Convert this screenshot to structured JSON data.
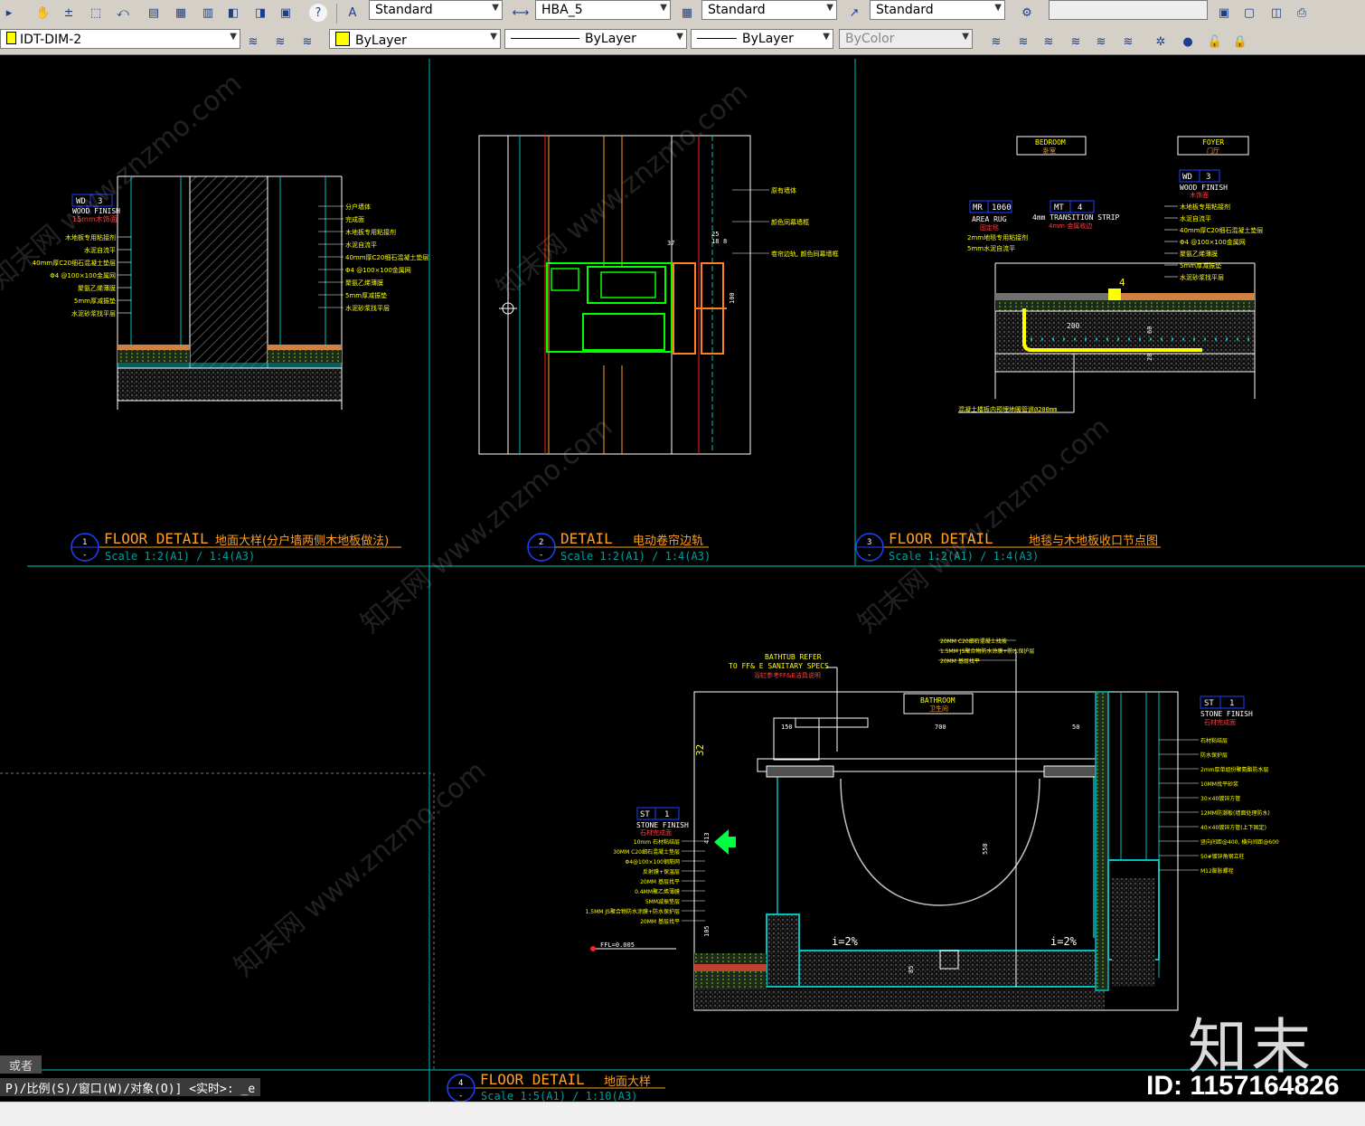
{
  "toolbar_top": {
    "text_style": "Standard",
    "dim_style": "HBA_5",
    "table_style": "Standard",
    "mleader_style": "Standard",
    "search_value": ""
  },
  "toolbar_props": {
    "layer": "IDT-DIM-2",
    "color": "ByLayer",
    "linetype": "ByLayer",
    "lineweight": "ByLayer",
    "plotstyle": "ByColor"
  },
  "colors": {
    "viewport_border": "#00a0a0",
    "title_text": "#ffa020",
    "annotation": "#ffff00",
    "background": "#000000"
  },
  "details": [
    {
      "num": "1",
      "sub": "-",
      "title_en": "FLOOR DETAIL",
      "title_cn": "地面大样(分户墙两侧木地板做法)",
      "scale": "Scale 1:2(A1) / 1:4(A3)"
    },
    {
      "num": "2",
      "sub": "-",
      "title_en": "DETAIL",
      "title_cn": "电动卷帘边轨",
      "scale": "Scale 1:2(A1) / 1:4(A3)"
    },
    {
      "num": "3",
      "sub": "-",
      "title_en": "FLOOR DETAIL",
      "title_cn": "地毯与木地板收口节点图",
      "scale": "Scale 1:2(A1) / 1:4(A3)"
    },
    {
      "num": "4",
      "sub": "-",
      "title_en": "FLOOR DETAIL",
      "title_cn": "地面大样",
      "scale": "Scale 1:5(A1) / 1:10(A3)"
    }
  ],
  "d1": {
    "tag_code": "WD",
    "tag_num": "3",
    "tag_en": "WOOD FINISH",
    "tag_cn": "15mm木饰面",
    "left_notes": [
      "木地板专用粘接剂",
      "水泥自流平",
      "40mm厚C20细石混凝土垫层",
      "Φ4 @100×100金属网",
      "聚氨乙烯薄膜",
      "5mm厚减振垫",
      "水泥砂浆找平层"
    ],
    "right_notes": [
      "分户墙体",
      "完成面",
      "木地板专用粘接剂",
      "水泥自流平",
      "40mm厚C20细石混凝土垫层",
      "Φ4 @100×100金属网",
      "聚氨乙烯薄膜",
      "5mm厚减振垫",
      "水泥砂浆找平层"
    ]
  },
  "d2": {
    "notes": [
      "原有墙体",
      "颜色同幕墙框",
      "卷帘边轨, 颜色同幕墙框"
    ],
    "dims": [
      "37",
      "25",
      "18",
      "8",
      "100"
    ]
  },
  "d3": {
    "bedroom": "BEDROOM",
    "bedroom_cn": "卧室",
    "foyer": "FOYER",
    "foyer_cn": "门厅",
    "mr_code": "MR",
    "mr_num": "1060",
    "mr_en": "AREA RUG",
    "mr_cn": "固定毯",
    "mt_code": "MT",
    "mt_num": "4",
    "mt_en": "4mm TRANSITION STRIP",
    "mt_cn": "4mm 金属收边",
    "wd_code": "WD",
    "wd_num": "3",
    "wd_en": "WOOD FINISH",
    "wd_cn": "木饰面",
    "left_notes": [
      "2mm地毯专用粘接剂",
      "5mm水泥自流平"
    ],
    "right_notes": [
      "木地板专用粘接剂",
      "水泥自流平",
      "40mm厚C20细石混凝土垫层",
      "Φ4 @100×100金属网",
      "聚氨乙烯薄膜",
      "5mm厚减振垫",
      "水泥砂浆找平层"
    ],
    "bottom_note": "混凝土楼板内预埋地暖管道@200mm",
    "dims": [
      "4",
      "200",
      "60",
      "20"
    ]
  },
  "d4": {
    "bath_ref1": "BATHTUB REFER",
    "bath_ref2": "TO FF& E SANITARY SPECS",
    "bath_ref3": "浴缸参考FF&E洁具说明",
    "bathroom": "BATHROOM",
    "bathroom_cn": "卫生间",
    "top_notes": [
      "20MM C20细石混凝土找坡",
      "1.5MM JS聚合物防水涂膜+防水保护层",
      "20MM 基层找平"
    ],
    "st1_code": "ST",
    "st1_num": "1",
    "st1_en": "STONE FINISH",
    "st1_cn": "石材完成面",
    "st2_code": "ST",
    "st2_num": "1",
    "st2_en": "STONE FINISH",
    "st2_cn": "石材完成面",
    "left_notes": [
      "10mm 石材粘结层",
      "30MM C20细石混凝土垫层",
      "Φ4@100×100钢筋网",
      "反射膜+保温层",
      "20MM 基层找平",
      "0.4MM聚乙烯薄膜",
      "5MM减振垫层",
      "1.5MM JS聚合物防水涂膜+防水保护层",
      "20MM 基层找平"
    ],
    "right_notes": [
      "石材粘结层",
      "防水保护层",
      "2mm厚单组份聚氨酯防水层",
      "10MM找平砂浆",
      "30×40镀锌方管",
      "12MM防潮板(墙面处理防水)",
      "40×40镀锌方管(上下固定)",
      "竖向间距@400, 横向间距@600",
      "50#镀锌角钢立柱",
      "M12膨胀螺栓"
    ],
    "dims": [
      "150",
      "700",
      "50",
      "40",
      "413",
      "550",
      "105",
      "85",
      "20",
      "32"
    ],
    "slope_left": "i=2%",
    "slope_right": "i=2%",
    "ffl": "FFL=0.005"
  },
  "watermark": "知末网 www.znzmo.com",
  "brand": "知末",
  "id_label": "ID: 1157164826",
  "command_history": "或者",
  "command_line": "P)/比例(S)/窗口(W)/对象(O)] <实时>: _e"
}
